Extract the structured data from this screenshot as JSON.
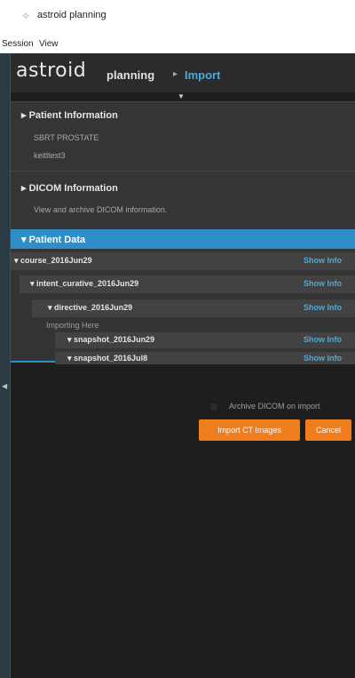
{
  "window": {
    "title": "astroid planning",
    "icon": "app-icon"
  },
  "menubar": {
    "items": [
      "Session",
      "View"
    ]
  },
  "header": {
    "logo": "astroid",
    "crumb_root": "planning",
    "crumb_separator": "▸",
    "crumb_current": "Import"
  },
  "panels": [
    {
      "title": "Patient Information",
      "lines": [
        "SBRT PROSTATE",
        "keitltest3"
      ]
    },
    {
      "title": "DICOM Information",
      "lines": [
        "View and archive DICOM information."
      ]
    }
  ],
  "patient_data": {
    "title": "Patient Data",
    "rows": [
      {
        "label": "course_2016Jun29",
        "info": "Show Info"
      },
      {
        "label": "intent_curative_2016Jun29",
        "info": "Show Info"
      },
      {
        "label": "directive_2016Jun29",
        "info": "Show Info",
        "sub": "Importing Here"
      },
      {
        "label": "snapshot_2016Jun29",
        "info": "Show Info"
      },
      {
        "label": "snapshot_2016Jul8",
        "info": "Show Info"
      }
    ]
  },
  "footer": {
    "archive_label": "Archive DICOM on import",
    "archive_checked": false,
    "import_button": "Import CT Images",
    "cancel_button": "Cancel"
  },
  "colors": {
    "accent_blue": "#2f8ec8",
    "link_blue": "#4fa8d8",
    "button_orange": "#f07d1e",
    "background": "#1e1e1e"
  }
}
